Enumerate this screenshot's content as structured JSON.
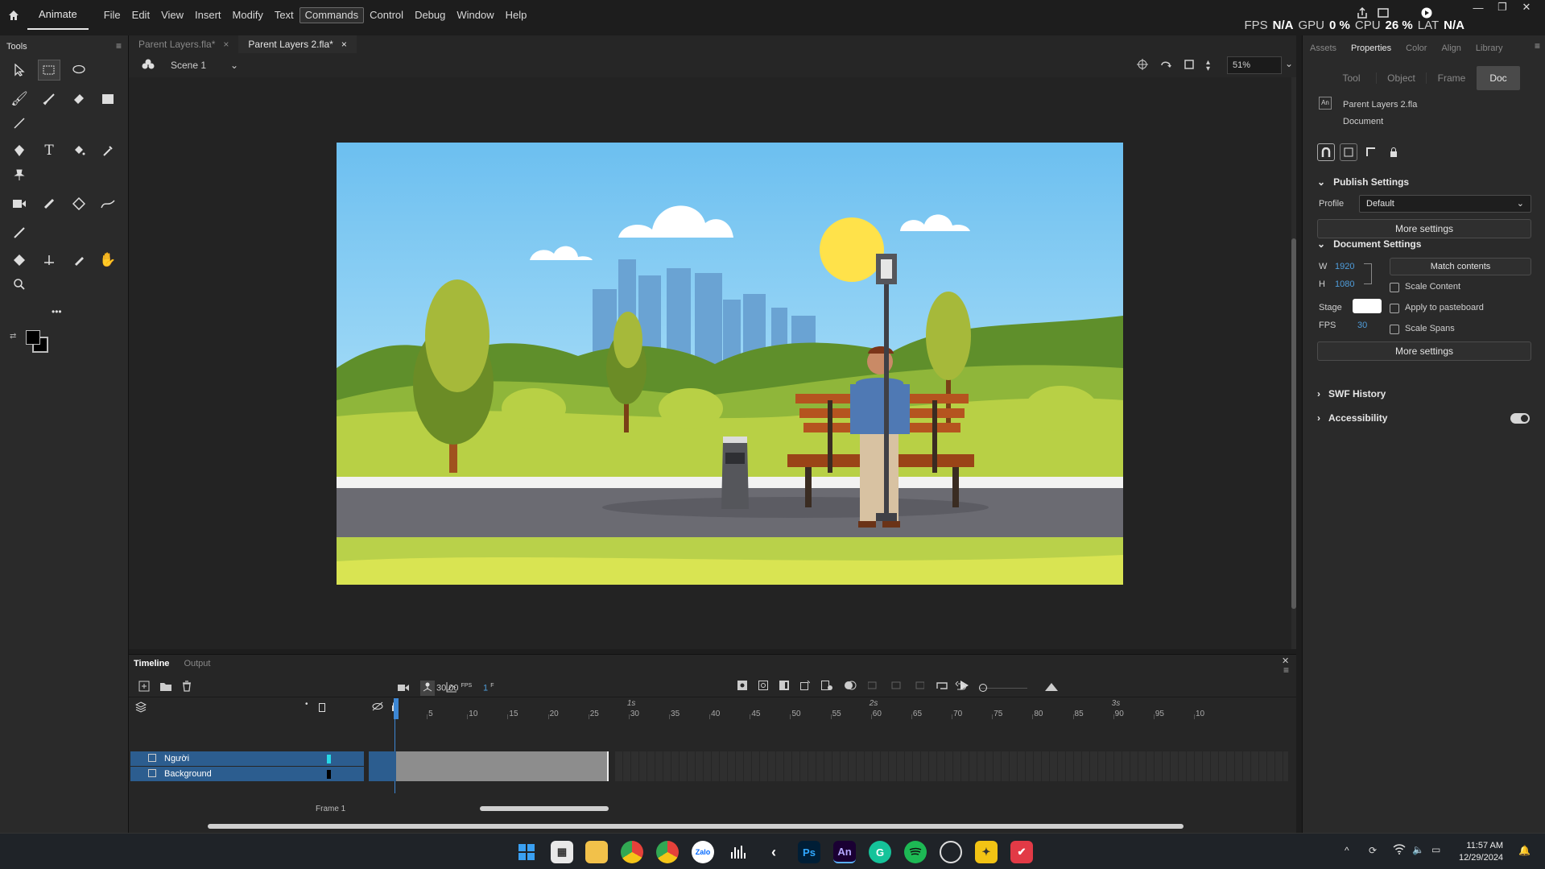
{
  "menubar": {
    "app_name": "Animate",
    "items": [
      "File",
      "Edit",
      "View",
      "Insert",
      "Modify",
      "Text",
      "Commands",
      "Control",
      "Debug",
      "Window",
      "Help"
    ],
    "active_item": "Commands",
    "perf": {
      "fps_label": "FPS",
      "fps_value": "N/A",
      "gpu_label": "GPU",
      "gpu_value": "0 %",
      "cpu_label": "CPU",
      "cpu_value": "26 %",
      "lat_label": "LAT",
      "lat_value": "N/A"
    }
  },
  "tools": {
    "title": "Tools",
    "more": "•••"
  },
  "doc_tabs": [
    {
      "label": "Parent Layers.fla*",
      "close": "×"
    },
    {
      "label": "Parent Layers 2.fla*",
      "close": "×"
    }
  ],
  "scene": {
    "label": "Scene 1",
    "zoom": "51%"
  },
  "properties": {
    "panel_tabs": [
      "Assets",
      "Properties",
      "Color",
      "Align",
      "Library"
    ],
    "active_panel_tab": "Properties",
    "sub_tabs": [
      "Tool",
      "Object",
      "Frame",
      "Doc"
    ],
    "active_sub_tab": "Doc",
    "doc_name": "Parent Layers 2.fla",
    "doc_type": "Document",
    "publish": {
      "title": "Publish Settings",
      "profile_label": "Profile",
      "profile_value": "Default",
      "more": "More settings"
    },
    "document": {
      "title": "Document Settings",
      "w_label": "W",
      "w_value": "1920",
      "h_label": "H",
      "h_value": "1080",
      "match": "Match contents",
      "scale_content": "Scale Content",
      "stage_label": "Stage",
      "apply_pasteboard": "Apply to pasteboard",
      "fps_label": "FPS",
      "fps_value": "30",
      "scale_spans": "Scale Spans",
      "more": "More settings"
    },
    "swf_history": "SWF History",
    "accessibility": "Accessibility"
  },
  "timeline": {
    "tabs": [
      "Timeline",
      "Output"
    ],
    "fps": "30.00",
    "fps_unit": "FPS",
    "frame": "1",
    "frame_unit": "F",
    "seconds": [
      "1s",
      "2s",
      "3s"
    ],
    "ticks": [
      "5",
      "10",
      "15",
      "20",
      "25",
      "30",
      "35",
      "40",
      "45",
      "50",
      "55",
      "60",
      "65",
      "70",
      "75",
      "80",
      "85",
      "90",
      "95",
      "10"
    ],
    "layers": [
      {
        "name": "Người",
        "color": "#27d9e6"
      },
      {
        "name": "Background",
        "color": "#000000"
      }
    ],
    "frame_label": "Frame 1"
  },
  "taskbar": {
    "time": "11:57 AM",
    "date": "12/29/2024",
    "apps": [
      "windows-start",
      "file-explorer-alt",
      "file-explorer",
      "chrome",
      "chrome-profile",
      "zalo",
      "audio-app",
      "capcut",
      "photoshop",
      "animate",
      "grammarly",
      "spotify",
      "obs",
      "app-yellow",
      "app-red"
    ],
    "app_labels": {
      "zalo": "Zalo",
      "photoshop": "Ps",
      "animate": "An",
      "grammarly": "G"
    }
  },
  "colors": {
    "accent": "#4f9ddb",
    "layer_highlight": "#2c5d8f",
    "sky": "#7dc6ef",
    "grass": "#c7d94c"
  }
}
